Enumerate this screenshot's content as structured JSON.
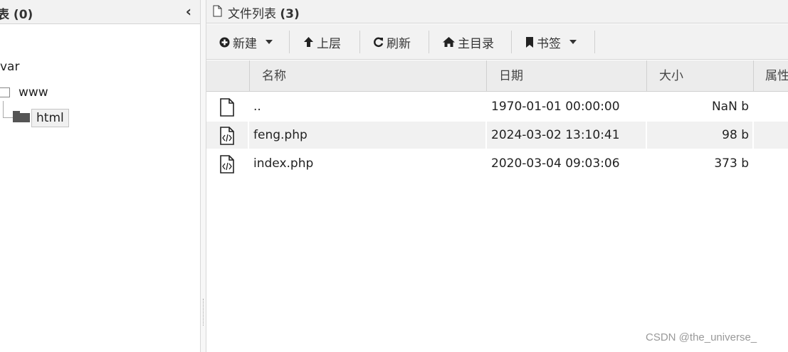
{
  "left_panel": {
    "title": "表 (0)",
    "collapse_glyph": "‹",
    "tree": {
      "var": "var",
      "www": "www",
      "html": "html"
    }
  },
  "right_panel": {
    "title_text": "文件列表",
    "title_count": "(3)",
    "toolbar": {
      "new": "新建",
      "up": "上层",
      "refresh": "刷新",
      "home": "主目录",
      "bookmark": "书签"
    },
    "columns": [
      "名称",
      "日期",
      "大小",
      "属性"
    ],
    "rows": [
      {
        "name": "..",
        "date": "1970-01-01 00:00:00",
        "size": "NaN b",
        "icon": "file-icon"
      },
      {
        "name": "feng.php",
        "date": "2024-03-02 13:10:41",
        "size": "98 b",
        "icon": "code-file-icon"
      },
      {
        "name": "index.php",
        "date": "2020-03-04 09:03:06",
        "size": "373 b",
        "icon": "code-file-icon"
      }
    ]
  },
  "watermark": "CSDN @the_universe_"
}
